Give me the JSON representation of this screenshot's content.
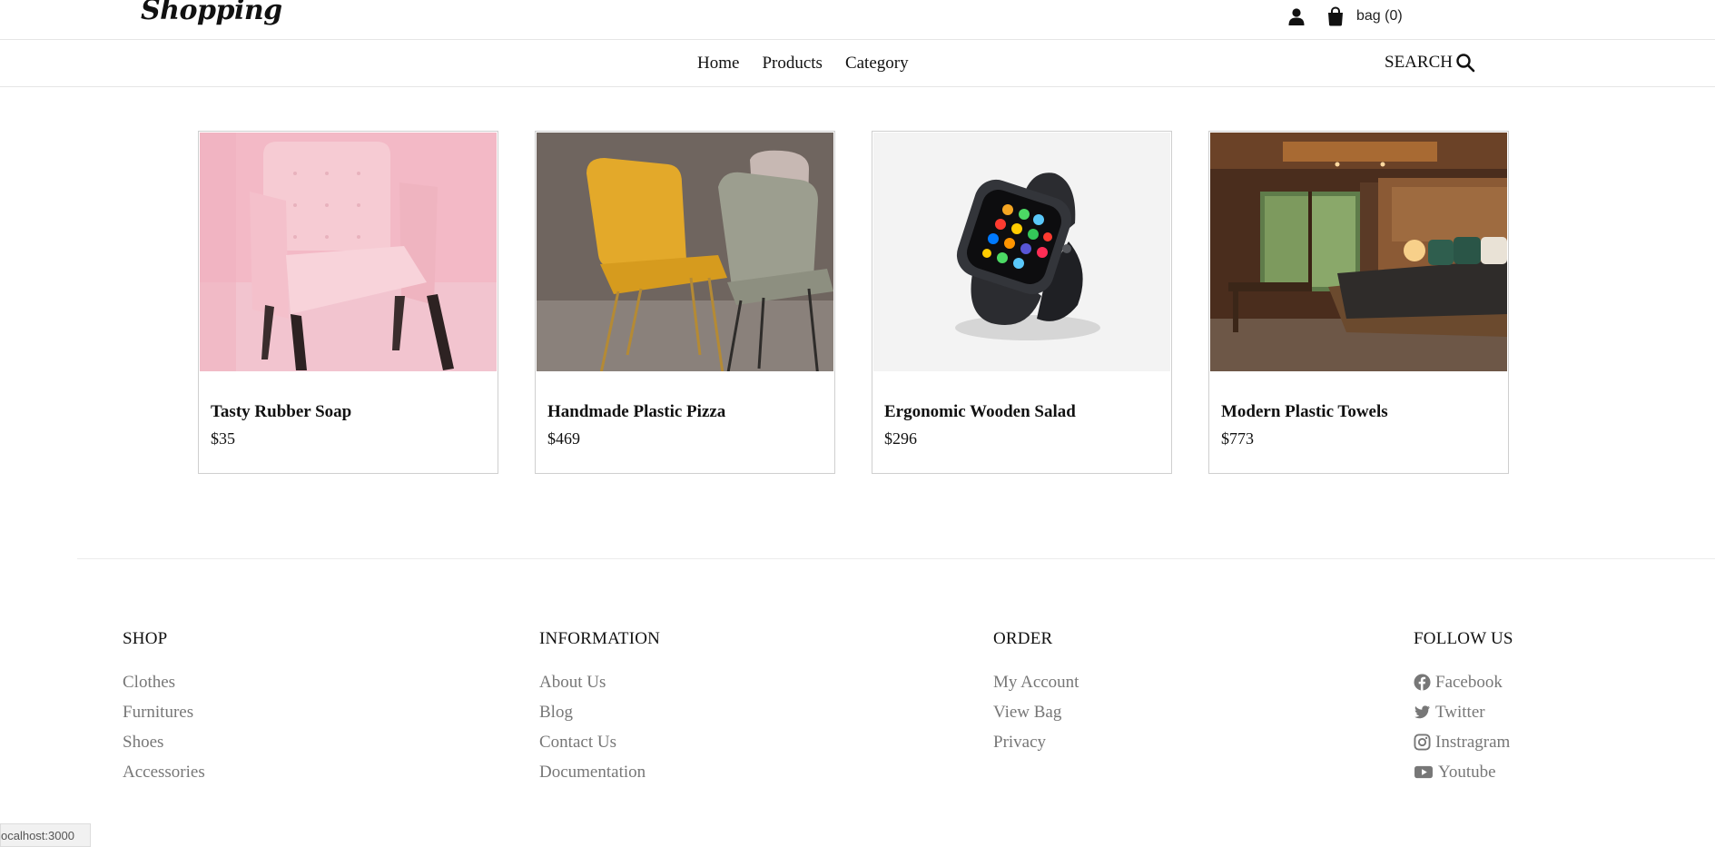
{
  "header": {
    "logo": "Shopping",
    "bag_label": "bag (0)"
  },
  "nav": {
    "links": [
      "Home",
      "Products",
      "Category"
    ],
    "search_label": "SEARCH"
  },
  "products": [
    {
      "name": "Tasty Rubber Soap",
      "price": "$35"
    },
    {
      "name": "Handmade Plastic Pizza",
      "price": "$469"
    },
    {
      "name": "Ergonomic Wooden Salad",
      "price": "$296"
    },
    {
      "name": "Modern Plastic Towels",
      "price": "$773"
    }
  ],
  "footer": {
    "shop": {
      "title": "SHOP",
      "links": [
        "Clothes",
        "Furnitures",
        "Shoes",
        "Accessories"
      ]
    },
    "information": {
      "title": "INFORMATION",
      "links": [
        "About Us",
        "Blog",
        "Contact Us",
        "Documentation"
      ]
    },
    "order": {
      "title": "ORDER",
      "links": [
        "My Account",
        "View Bag",
        "Privacy"
      ]
    },
    "follow": {
      "title": "FOLLOW US",
      "links": [
        "Facebook",
        "Twitter",
        "Instragram",
        "Youtube"
      ]
    }
  },
  "status_bar": {
    "url": "ocalhost:3000"
  },
  "icons": {
    "user": "user-icon",
    "bag": "shopping-bag-icon",
    "search": "search-icon",
    "facebook": "facebook-icon",
    "twitter": "twitter-icon",
    "instagram": "instagram-icon",
    "youtube": "youtube-icon"
  }
}
